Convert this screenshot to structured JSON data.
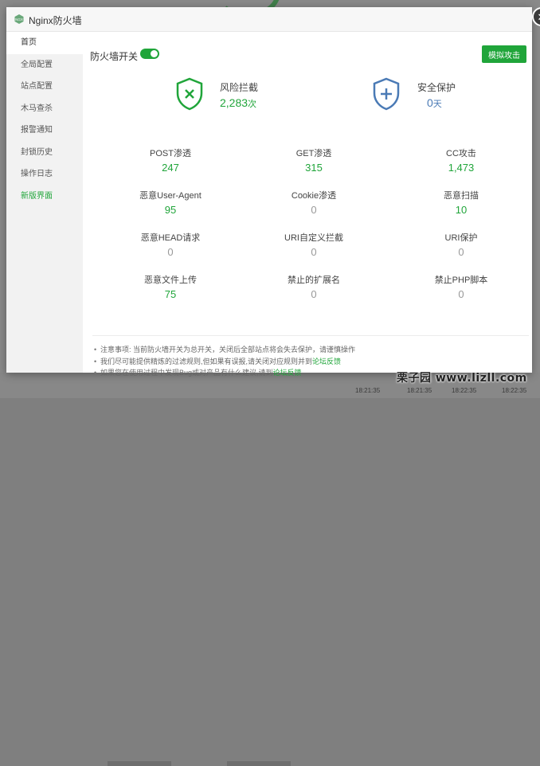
{
  "window": {
    "title": "Nginx防火墙",
    "close_icon": "close-icon"
  },
  "sidebar": {
    "items": [
      {
        "label": "首页",
        "active": true
      },
      {
        "label": "全局配置"
      },
      {
        "label": "站点配置"
      },
      {
        "label": "木马查杀"
      },
      {
        "label": "报警通知"
      },
      {
        "label": "封锁历史"
      },
      {
        "label": "操作日志"
      },
      {
        "label": "新版界面",
        "highlight": true
      }
    ]
  },
  "header": {
    "switch_label": "防火墙开关",
    "switch_on": true,
    "simulate_button": "模拟攻击"
  },
  "summary": {
    "risk": {
      "title": "风险拦截",
      "value": "2,283",
      "unit": "次",
      "icon": "shield-x-icon"
    },
    "safe": {
      "title": "安全保护",
      "value": "0",
      "unit": "天",
      "icon": "shield-plus-icon"
    }
  },
  "stats": [
    {
      "label": "POST渗透",
      "value": "247"
    },
    {
      "label": "GET渗透",
      "value": "315"
    },
    {
      "label": "CC攻击",
      "value": "1,473"
    },
    {
      "label": "恶意User-Agent",
      "value": "95"
    },
    {
      "label": "Cookie渗透",
      "value": "0"
    },
    {
      "label": "恶意扫描",
      "value": "10"
    },
    {
      "label": "恶意HEAD请求",
      "value": "0"
    },
    {
      "label": "URI自定义拦截",
      "value": "0"
    },
    {
      "label": "URI保护",
      "value": "0"
    },
    {
      "label": "恶意文件上传",
      "value": "75"
    },
    {
      "label": "禁止的扩展名",
      "value": "0"
    },
    {
      "label": "禁止PHP脚本",
      "value": "0"
    }
  ],
  "notes": {
    "n1": "注意事项: 当前防火墙开关为总开关，关闭后全部站点将会失去保护，请谨慎操作",
    "n2_text": "我们尽可能提供精炼的过滤规则,但如果有误报,请关闭对应规则并到",
    "n2_link": "论坛反馈",
    "n3_text": "如果您在使用过程中发现Bug或对产品有什么建议,请到",
    "n3_link": "论坛反馈"
  },
  "background": {
    "ticks": [
      "18:21:35",
      "18:21:35",
      "18:22:35",
      "18:22:35"
    ]
  },
  "watermark": "栗子园  www.lizll.com",
  "colors": {
    "accent": "#20a53a",
    "blue": "#4a7ab5",
    "zero": "#999999"
  }
}
